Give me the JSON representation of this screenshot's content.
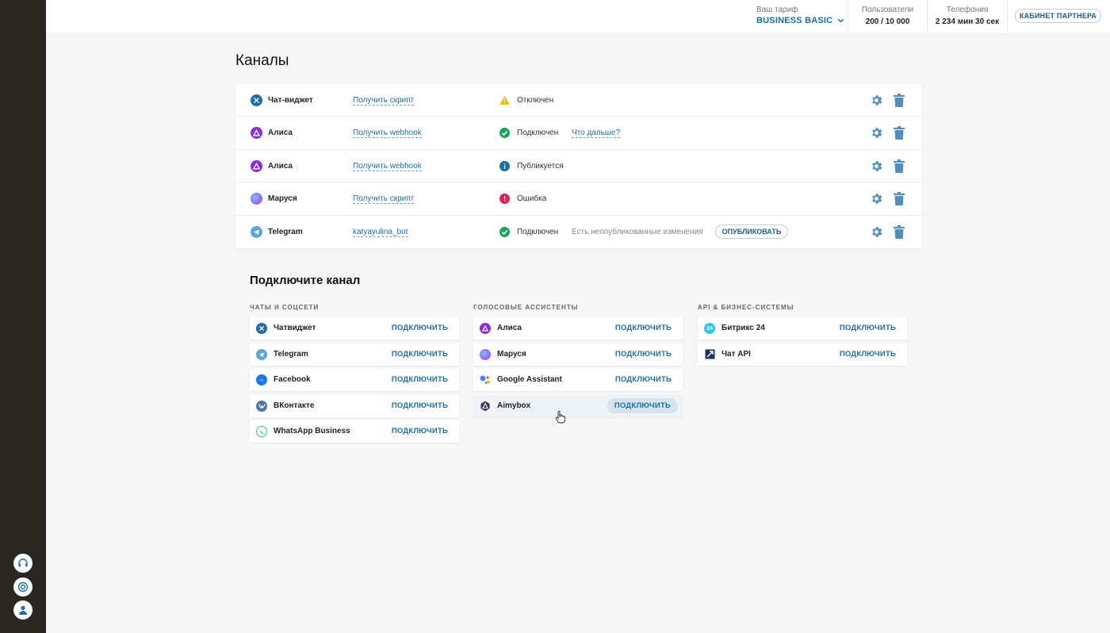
{
  "header": {
    "tariff_label": "Ваш тариф",
    "tariff_value": "BUSINESS BASIC",
    "users_label": "Пользователи",
    "users_value": "200 / 10 000",
    "phone_label": "Телефония",
    "phone_value": "2 234 мин 30 сек",
    "partner_button": "КАБИНЕТ ПАРТНЕРА"
  },
  "page_title": "Каналы",
  "channels": [
    {
      "name": "Чат-виджет",
      "link": "Получить скрипт",
      "status": "Отключен",
      "status_type": "warning",
      "extra": ""
    },
    {
      "name": "Алиса",
      "link": "Получить webhook",
      "status": "Подключен",
      "status_type": "success",
      "extra": "Что дальше?"
    },
    {
      "name": "Алиса",
      "link": "Получить webhook",
      "status": "Публикуется",
      "status_type": "info",
      "extra": ""
    },
    {
      "name": "Маруся",
      "link": "Получить скрипт",
      "status": "Ошибка",
      "status_type": "error",
      "extra": ""
    },
    {
      "name": "Telegram",
      "link": "katyayulina_bot",
      "status": "Подключен",
      "status_type": "success",
      "extra": "Есть неопубликованные изменения",
      "action": "ОПУБЛИКОВАТЬ"
    }
  ],
  "connect": {
    "title": "Подключите канал",
    "action_label": "ПОДКЛЮЧИТЬ",
    "columns": [
      {
        "heading": "ЧАТЫ И СОЦСЕТИ",
        "items": [
          "Чатвиджет",
          "Telegram",
          "Facebook",
          "ВКонтакте",
          "WhatsApp Business"
        ]
      },
      {
        "heading": "ГОЛОСОВЫЕ АССИСТЕНТЫ",
        "items": [
          "Алиса",
          "Маруся",
          "Google Assistant",
          "Aimybox"
        ]
      },
      {
        "heading": "API & БИЗНЕС-СИСТЕМЫ",
        "items": [
          "Битрикс 24",
          "Чат API"
        ]
      }
    ]
  },
  "colors": {
    "accent": "#1a6fa8",
    "sidebar": "#2a2621",
    "success": "#1aa35a",
    "warning": "#f2b705",
    "info": "#1a6fa8",
    "error": "#e0224f"
  }
}
